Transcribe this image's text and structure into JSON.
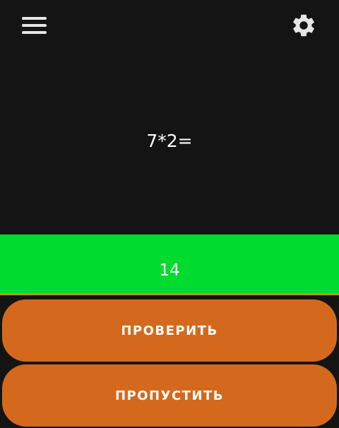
{
  "header": {
    "menu_icon": "hamburger-menu-icon",
    "settings_icon": "gear-icon"
  },
  "quiz": {
    "question": "7*2=",
    "answer": "14"
  },
  "actions": {
    "check_label": "ПРОВЕРИТЬ",
    "skip_label": "ПРОПУСТИТЬ"
  },
  "colors": {
    "background": "#141414",
    "answer_bg": "#00dc2f",
    "button_bg": "#d4691e",
    "text": "#ffffff"
  }
}
